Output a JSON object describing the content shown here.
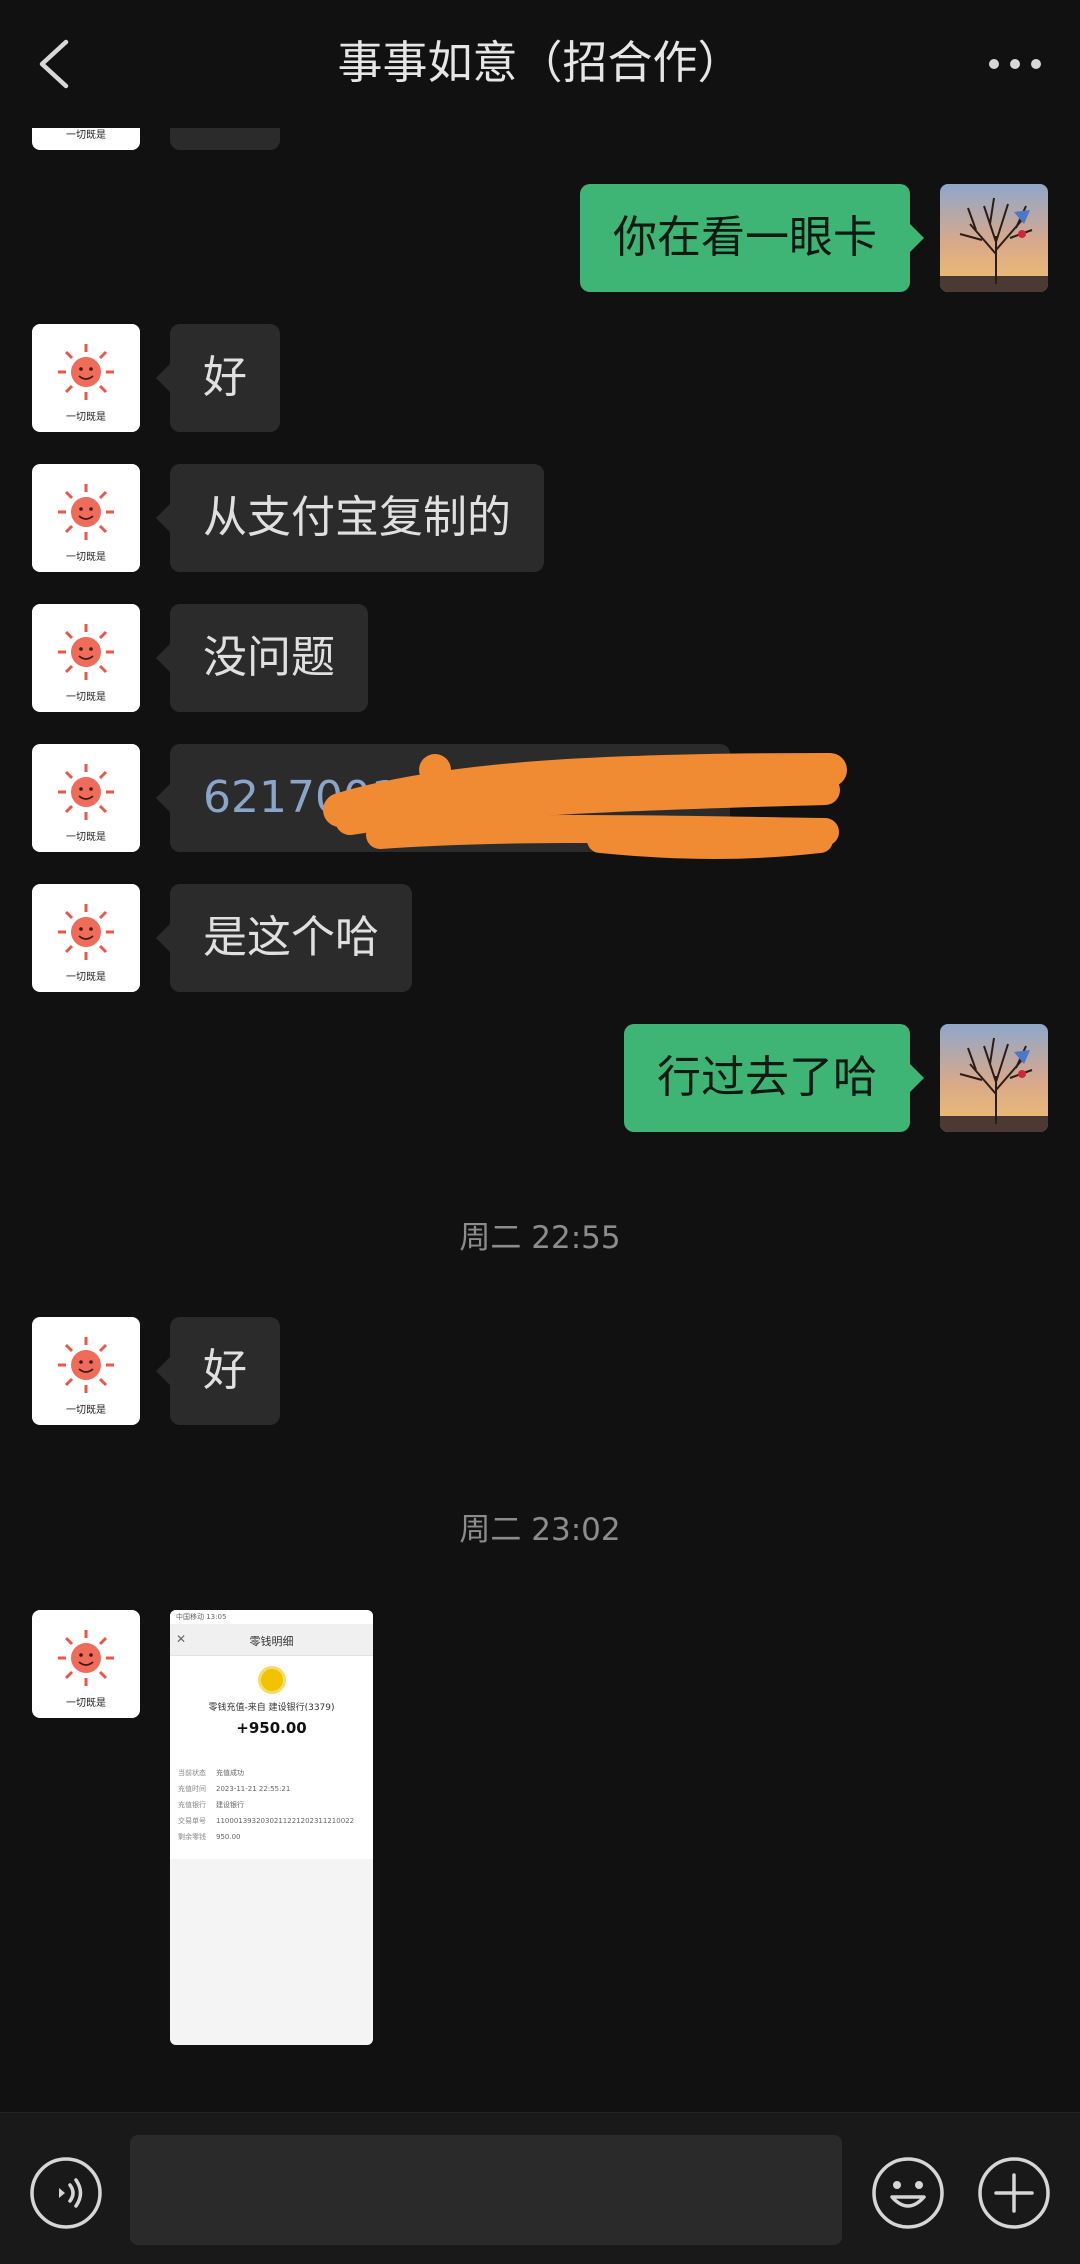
{
  "header": {
    "title": "事事如意（招合作）"
  },
  "avatars": {
    "contact_caption": "一切既是"
  },
  "messages": [
    {
      "side": "in",
      "text": ""
    },
    {
      "side": "out",
      "text": "你在看一眼卡"
    },
    {
      "side": "in",
      "text": "好"
    },
    {
      "side": "in",
      "text": "从支付宝复制的"
    },
    {
      "side": "in",
      "text": "没问题"
    },
    {
      "side": "in",
      "text": "62170013"
    },
    {
      "side": "in",
      "text": "是这个哈"
    },
    {
      "side": "out",
      "text": "行过去了哈"
    },
    {
      "side": "in",
      "text": "好"
    }
  ],
  "timestamps": [
    "周二 22:55",
    "周二 23:02"
  ],
  "image_message": {
    "status_bar": "中国移动 13:05",
    "title": "零钱明细",
    "from": "零钱充值-来自 建设银行(3379)",
    "amount": "+950.00",
    "rows": [
      {
        "k": "当前状态",
        "v": "充值成功"
      },
      {
        "k": "充值时间",
        "v": "2023-11-21 22:55:21"
      },
      {
        "k": "充值银行",
        "v": "建设银行"
      },
      {
        "k": "交易单号",
        "v": "1100013932030211221202311210022"
      },
      {
        "k": "剩余零钱",
        "v": "950.00"
      }
    ]
  },
  "input": {
    "value": "",
    "placeholder": ""
  },
  "colors": {
    "background": "#111111",
    "bubble_incoming": "#2b2b2b",
    "bubble_outgoing": "#3eb575",
    "redaction_scribble": "#f08a33"
  }
}
